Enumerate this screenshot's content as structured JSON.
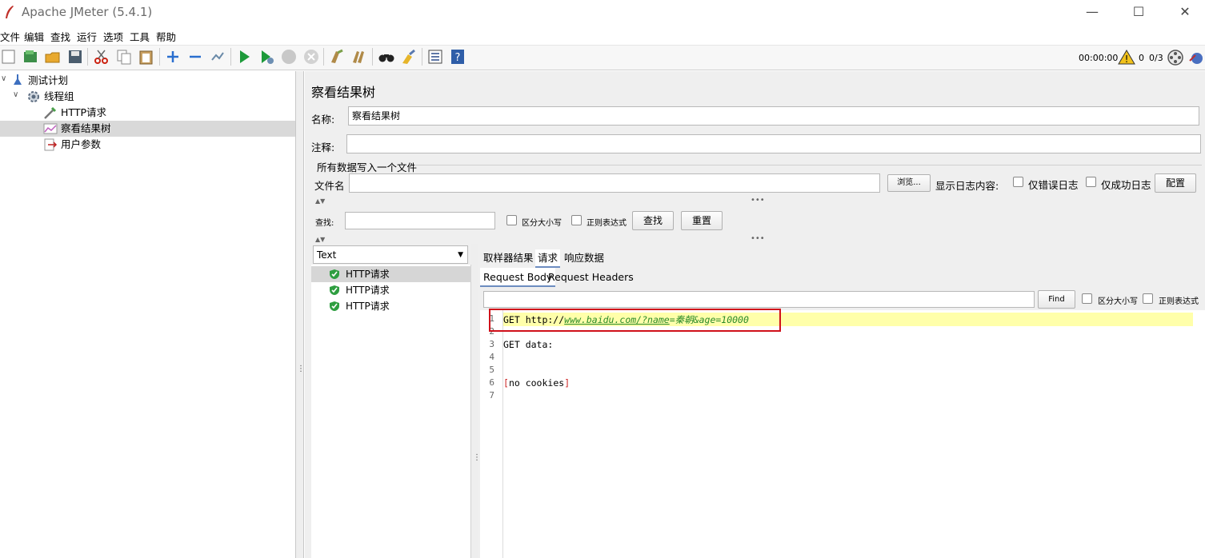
{
  "window": {
    "title": "Apache JMeter (5.4.1)"
  },
  "menu": [
    "文件",
    "编辑",
    "查找",
    "运行",
    "选项",
    "工具",
    "帮助"
  ],
  "status": {
    "time": "00:00:00",
    "warnings": "0",
    "threads": "0/3"
  },
  "tree": [
    {
      "label": "测试计划",
      "icon": "test-plan-icon"
    },
    {
      "label": "线程组",
      "icon": "gear-icon"
    },
    {
      "label": "HTTP请求",
      "icon": "pipette-icon"
    },
    {
      "label": "察看结果树",
      "icon": "graph-icon",
      "selected": true
    },
    {
      "label": "用户参数",
      "icon": "params-icon"
    }
  ],
  "panel": {
    "title": "察看结果树",
    "name_label": "名称:",
    "name_value": "察看结果树",
    "comment_label": "注释:",
    "file_group": "所有数据写入一个文件",
    "file_label": "文件名",
    "browse": "浏览...",
    "log_content": "显示日志内容:",
    "errors_only": "仅错误日志",
    "success_only": "仅成功日志",
    "configure": "配置",
    "search_label": "查找:",
    "case_sensitive": "区分大小写",
    "regex": "正则表达式",
    "search_button": "查找",
    "reset_button": "重置"
  },
  "renderer": {
    "selected": "Text"
  },
  "results": [
    "HTTP请求",
    "HTTP请求",
    "HTTP请求"
  ],
  "tabs": [
    "取样器结果",
    "请求",
    "响应数据"
  ],
  "subtabs": [
    "Request Body",
    "Request Headers"
  ],
  "find": {
    "button": "Find",
    "case": "区分大小写",
    "regex": "正则表达式"
  },
  "code": {
    "line1_prefix": "GET http://",
    "line1_url": "www.baidu.com/?name",
    "line1_eq": "=",
    "line1_params": "秦朝&age=10000",
    "line3": "GET data:",
    "line6_open": "[",
    "line6_text": "no cookies",
    "line6_close": "]",
    "line_numbers": [
      "1",
      "2",
      "3",
      "4",
      "5",
      "6",
      "7"
    ]
  },
  "colors": {
    "highlight_box": "#d0101a",
    "line_highlight": "#ffffaa",
    "url_green": "#2a8a2a",
    "bracket_red": "#cc2222"
  }
}
